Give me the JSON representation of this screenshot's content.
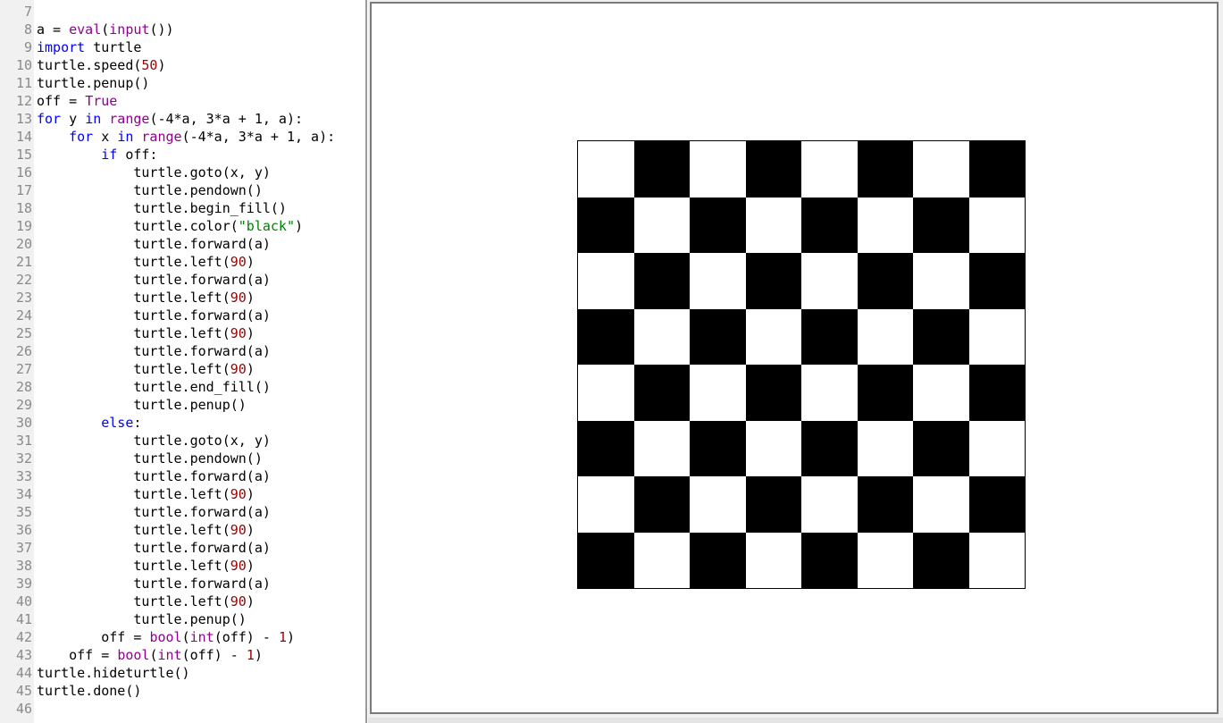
{
  "editor": {
    "lines": [
      {
        "n": "7",
        "tokens": []
      },
      {
        "n": "8",
        "tokens": [
          [
            "code",
            "a = "
          ],
          [
            "bi",
            "eval"
          ],
          [
            "code",
            "("
          ],
          [
            "bi",
            "input"
          ],
          [
            "code",
            "())"
          ]
        ]
      },
      {
        "n": "9",
        "tokens": [
          [
            "kw",
            "import"
          ],
          [
            "code",
            " turtle"
          ]
        ]
      },
      {
        "n": "10",
        "tokens": [
          [
            "code",
            "turtle.speed("
          ],
          [
            "num",
            "50"
          ],
          [
            "code",
            ")"
          ]
        ]
      },
      {
        "n": "11",
        "tokens": [
          [
            "code",
            "turtle.penup()"
          ]
        ]
      },
      {
        "n": "12",
        "tokens": [
          [
            "code",
            "off = "
          ],
          [
            "bi",
            "True"
          ]
        ]
      },
      {
        "n": "13",
        "tokens": [
          [
            "kw",
            "for"
          ],
          [
            "code",
            " y "
          ],
          [
            "kw",
            "in"
          ],
          [
            "code",
            " "
          ],
          [
            "bi",
            "range"
          ],
          [
            "code",
            "(-4*a, 3*a + 1, a):"
          ]
        ]
      },
      {
        "n": "14",
        "tokens": [
          [
            "code",
            "    "
          ],
          [
            "kw",
            "for"
          ],
          [
            "code",
            " x "
          ],
          [
            "kw",
            "in"
          ],
          [
            "code",
            " "
          ],
          [
            "bi",
            "range"
          ],
          [
            "code",
            "(-4*a, 3*a + 1, a):"
          ]
        ]
      },
      {
        "n": "15",
        "tokens": [
          [
            "code",
            "        "
          ],
          [
            "kw",
            "if"
          ],
          [
            "code",
            " off:"
          ]
        ]
      },
      {
        "n": "16",
        "tokens": [
          [
            "code",
            "            turtle.goto(x, y)"
          ]
        ]
      },
      {
        "n": "17",
        "tokens": [
          [
            "code",
            "            turtle.pendown()"
          ]
        ]
      },
      {
        "n": "18",
        "tokens": [
          [
            "code",
            "            turtle.begin_fill()"
          ]
        ]
      },
      {
        "n": "19",
        "tokens": [
          [
            "code",
            "            turtle.color("
          ],
          [
            "str",
            "\"black\""
          ],
          [
            "code",
            ")"
          ]
        ]
      },
      {
        "n": "20",
        "tokens": [
          [
            "code",
            "            turtle.forward(a)"
          ]
        ]
      },
      {
        "n": "21",
        "tokens": [
          [
            "code",
            "            turtle.left("
          ],
          [
            "num",
            "90"
          ],
          [
            "code",
            ")"
          ]
        ]
      },
      {
        "n": "22",
        "tokens": [
          [
            "code",
            "            turtle.forward(a)"
          ]
        ]
      },
      {
        "n": "23",
        "tokens": [
          [
            "code",
            "            turtle.left("
          ],
          [
            "num",
            "90"
          ],
          [
            "code",
            ")"
          ]
        ]
      },
      {
        "n": "24",
        "tokens": [
          [
            "code",
            "            turtle.forward(a)"
          ]
        ]
      },
      {
        "n": "25",
        "tokens": [
          [
            "code",
            "            turtle.left("
          ],
          [
            "num",
            "90"
          ],
          [
            "code",
            ")"
          ]
        ]
      },
      {
        "n": "26",
        "tokens": [
          [
            "code",
            "            turtle.forward(a)"
          ]
        ]
      },
      {
        "n": "27",
        "tokens": [
          [
            "code",
            "            turtle.left("
          ],
          [
            "num",
            "90"
          ],
          [
            "code",
            ")"
          ]
        ]
      },
      {
        "n": "28",
        "tokens": [
          [
            "code",
            "            turtle.end_fill()"
          ]
        ]
      },
      {
        "n": "29",
        "tokens": [
          [
            "code",
            "            turtle.penup()"
          ]
        ]
      },
      {
        "n": "30",
        "tokens": [
          [
            "code",
            "        "
          ],
          [
            "kw",
            "else"
          ],
          [
            "code",
            ":"
          ]
        ]
      },
      {
        "n": "31",
        "tokens": [
          [
            "code",
            "            turtle.goto(x, y)"
          ]
        ]
      },
      {
        "n": "32",
        "tokens": [
          [
            "code",
            "            turtle.pendown()"
          ]
        ]
      },
      {
        "n": "33",
        "tokens": [
          [
            "code",
            "            turtle.forward(a)"
          ]
        ]
      },
      {
        "n": "34",
        "tokens": [
          [
            "code",
            "            turtle.left("
          ],
          [
            "num",
            "90"
          ],
          [
            "code",
            ")"
          ]
        ]
      },
      {
        "n": "35",
        "tokens": [
          [
            "code",
            "            turtle.forward(a)"
          ]
        ]
      },
      {
        "n": "36",
        "tokens": [
          [
            "code",
            "            turtle.left("
          ],
          [
            "num",
            "90"
          ],
          [
            "code",
            ")"
          ]
        ]
      },
      {
        "n": "37",
        "tokens": [
          [
            "code",
            "            turtle.forward(a)"
          ]
        ]
      },
      {
        "n": "38",
        "tokens": [
          [
            "code",
            "            turtle.left("
          ],
          [
            "num",
            "90"
          ],
          [
            "code",
            ")"
          ]
        ]
      },
      {
        "n": "39",
        "tokens": [
          [
            "code",
            "            turtle.forward(a)"
          ]
        ]
      },
      {
        "n": "40",
        "tokens": [
          [
            "code",
            "            turtle.left("
          ],
          [
            "num",
            "90"
          ],
          [
            "code",
            ")"
          ]
        ]
      },
      {
        "n": "41",
        "tokens": [
          [
            "code",
            "            turtle.penup()"
          ]
        ]
      },
      {
        "n": "42",
        "tokens": [
          [
            "code",
            "        off = "
          ],
          [
            "bi",
            "bool"
          ],
          [
            "code",
            "("
          ],
          [
            "bi",
            "int"
          ],
          [
            "code",
            "(off) - "
          ],
          [
            "num",
            "1"
          ],
          [
            "code",
            ")"
          ]
        ]
      },
      {
        "n": "43",
        "tokens": [
          [
            "code",
            "    off = "
          ],
          [
            "bi",
            "bool"
          ],
          [
            "code",
            "("
          ],
          [
            "bi",
            "int"
          ],
          [
            "code",
            "(off) - "
          ],
          [
            "num",
            "1"
          ],
          [
            "code",
            ")"
          ]
        ]
      },
      {
        "n": "44",
        "tokens": [
          [
            "code",
            "turtle.hideturtle()"
          ]
        ]
      },
      {
        "n": "45",
        "tokens": [
          [
            "code",
            "turtle.done()"
          ]
        ]
      },
      {
        "n": "46",
        "tokens": []
      }
    ]
  },
  "turtle_canvas": {
    "board": {
      "rows": 8,
      "cols": 8,
      "top_left_black": false,
      "fill_color": "#000000",
      "empty_color": "#ffffff"
    }
  },
  "colors": {
    "keyword": "#0000ff",
    "builtin": "#900090",
    "number": "#990000",
    "string": "#008000",
    "line_number": "#8a8a8a"
  }
}
